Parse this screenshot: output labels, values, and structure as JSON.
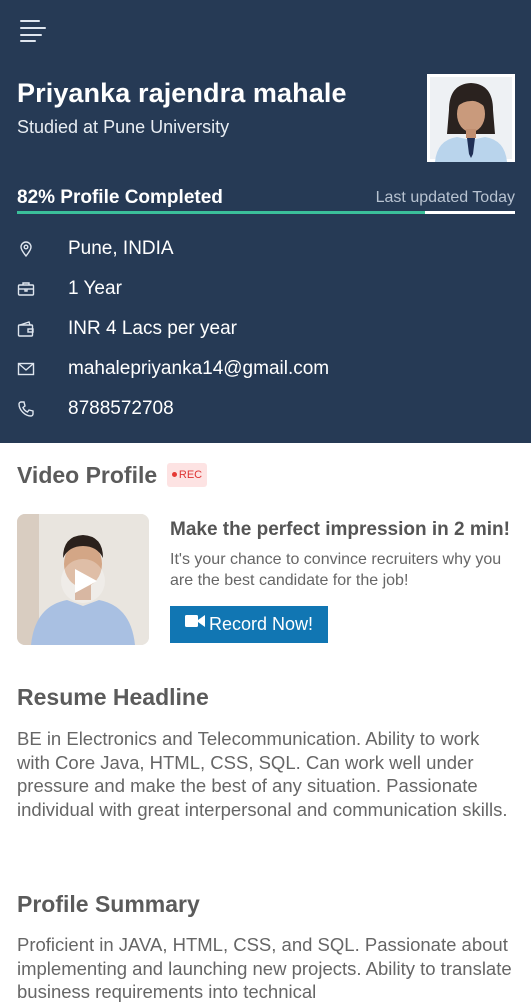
{
  "header": {
    "menu_icon": "hamburger-menu-icon",
    "name": "Priyanka rajendra mahale",
    "education": "Studied at Pune University",
    "profile_completion_percent": 82,
    "profile_completion_text": "82% Profile Completed",
    "last_updated": "Last updated Today",
    "colors": {
      "background": "#263a55",
      "progress": "#3bbf9a"
    }
  },
  "details": [
    {
      "icon": "location-pin-icon",
      "value": "Pune, INDIA"
    },
    {
      "icon": "briefcase-icon",
      "value": "1 Year"
    },
    {
      "icon": "wallet-icon",
      "value": "INR 4 Lacs per year"
    },
    {
      "icon": "mail-icon",
      "value": "mahalepriyanka14@gmail.com"
    },
    {
      "icon": "phone-icon",
      "value": "8788572708"
    }
  ],
  "video_profile": {
    "title": "Video Profile",
    "badge": "REC",
    "headline": "Make the perfect impression in 2 min!",
    "description": "It's your chance to convince recruiters why you are the best candidate for the job!",
    "button_label": "Record Now!",
    "button_color": "#1176b3"
  },
  "resume_headline": {
    "title": "Resume Headline",
    "text": "BE in Electronics and Telecommunication. Ability to work with Core Java, HTML, CSS, SQL. Can work well under pressure and make the best of any situation. Passionate individual with great interpersonal and communication skills."
  },
  "profile_summary": {
    "title": "Profile Summary",
    "text": "Proficient in JAVA, HTML, CSS, and SQL. Passionate about implementing and launching new projects. Ability to translate business requirements into technical"
  }
}
